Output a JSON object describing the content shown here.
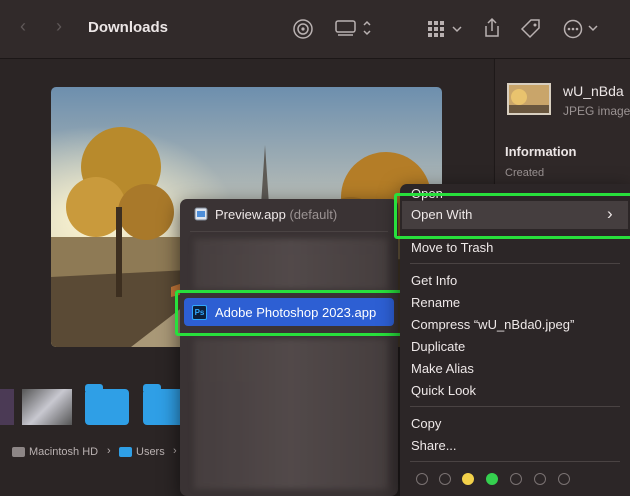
{
  "toolbar": {
    "title": "Downloads"
  },
  "info_panel": {
    "filename": "wU_nBda",
    "kind": "JPEG image",
    "section": "Information",
    "created_label": "Created"
  },
  "path_bar": {
    "items": [
      "Macintosh HD",
      "Users"
    ]
  },
  "open_with_submenu": {
    "default_app": "Preview.app",
    "default_suffix": "(default)",
    "highlighted_app": "Adobe Photoshop 2023.app",
    "ps_badge": "Ps"
  },
  "context_menu": {
    "open": "Open",
    "open_with": "Open With",
    "move_to_trash": "Move to Trash",
    "get_info": "Get Info",
    "rename": "Rename",
    "compress": "Compress “wU_nBda0.jpeg”",
    "duplicate": "Duplicate",
    "make_alias": "Make Alias",
    "quick_look": "Quick Look",
    "copy": "Copy",
    "share": "Share..."
  },
  "tag_colors": [
    "#2c2627",
    "#2c2627",
    "#f2d14a",
    "#35d04f",
    "#2c2627",
    "#2c2627",
    "#2c2627"
  ],
  "colors": {
    "highlight_outline": "#28e03c",
    "selection_blue": "#2d5fd3"
  }
}
